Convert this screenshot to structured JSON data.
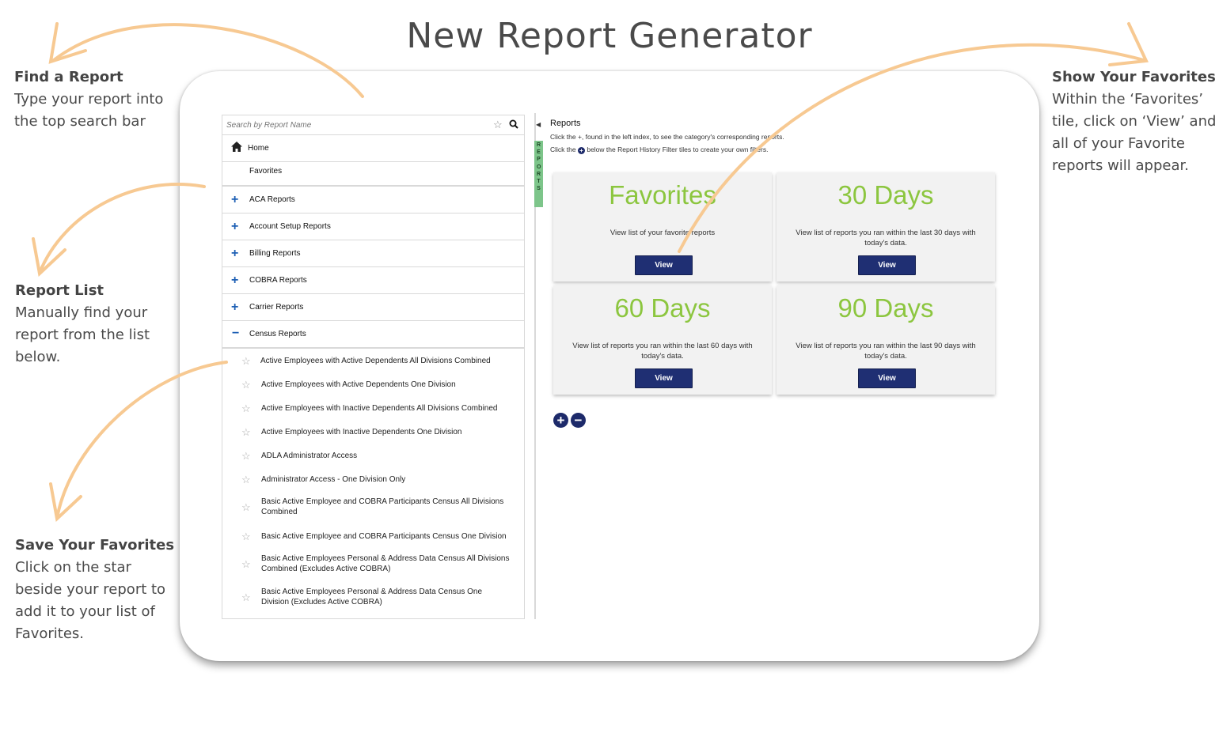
{
  "page": {
    "title": "New Report Generator"
  },
  "annotations": {
    "find": {
      "heading": "Find a Report",
      "lines": [
        "Type your report into",
        "the top search bar"
      ]
    },
    "list": {
      "heading": "Report List",
      "lines": [
        "Manually find your",
        "report from the list",
        "below."
      ]
    },
    "save": {
      "heading": "Save Your Favorites",
      "lines": [
        "Click on the star",
        "beside your report to",
        "add it to your list of",
        "Favorites."
      ]
    },
    "show": {
      "heading": "Show Your Favorites",
      "lines": [
        "Within the ‘Favorites’",
        "tile, click on ‘View’ and",
        "all of your Favorite",
        "reports will appear."
      ]
    }
  },
  "search": {
    "placeholder": "Search by Report Name",
    "star_icon": "star-icon",
    "search_icon": "search-icon"
  },
  "nav": {
    "home": "Home",
    "favorites": "Favorites",
    "categories": [
      {
        "label": "ACA Reports",
        "state": "collapsed"
      },
      {
        "label": "Account Setup Reports",
        "state": "collapsed"
      },
      {
        "label": "Billing Reports",
        "state": "collapsed"
      },
      {
        "label": "COBRA Reports",
        "state": "collapsed"
      },
      {
        "label": "Carrier Reports",
        "state": "collapsed"
      },
      {
        "label": "Census Reports",
        "state": "expanded"
      }
    ],
    "census_reports": [
      "Active Employees with Active Dependents All Divisions Combined",
      "Active Employees with Active Dependents One Division",
      "Active Employees with Inactive Dependents All Divisions Combined",
      "Active Employees with Inactive Dependents One Division",
      "ADLA Administrator Access",
      "Administrator Access - One Division Only",
      "Basic Active Employee and COBRA Participants Census All Divisions Combined",
      "Basic Active Employee and COBRA Participants Census One Division",
      "Basic Active Employees Personal & Address Data Census All Divisions Combined (Excludes Active COBRA)",
      "Basic Active Employees Personal & Address Data Census One Division (Excludes Active COBRA)"
    ]
  },
  "side_tab": {
    "label": "REPORTS"
  },
  "main": {
    "title": "Reports",
    "line1": "Click the +, found in the left index, to see the category's corresponding reports.",
    "line2_prefix": "Click the",
    "line2_suffix": "below the Report History Filter tiles to create your own filters.",
    "tiles": [
      {
        "title": "Favorites",
        "desc": "View list of your favorite reports",
        "button": "View"
      },
      {
        "title": "30 Days",
        "desc": "View list of reports you ran within the last 30 days with today's data.",
        "button": "View"
      },
      {
        "title": "60 Days",
        "desc": "View list of reports you ran within the last 60 days with today's data.",
        "button": "View"
      },
      {
        "title": "90 Days",
        "desc": "View list of reports you ran within the last 90 days with today's data.",
        "button": "View"
      }
    ],
    "add_filter_icon": "plus-circle-icon",
    "remove_filter_icon": "minus-circle-icon"
  },
  "colors": {
    "tile_title": "#8cc63f",
    "button_bg": "#1f2f73",
    "accent_blue": "#1d5fb4",
    "arrow": "#f7c992",
    "side_tab": "#7dc58a"
  }
}
